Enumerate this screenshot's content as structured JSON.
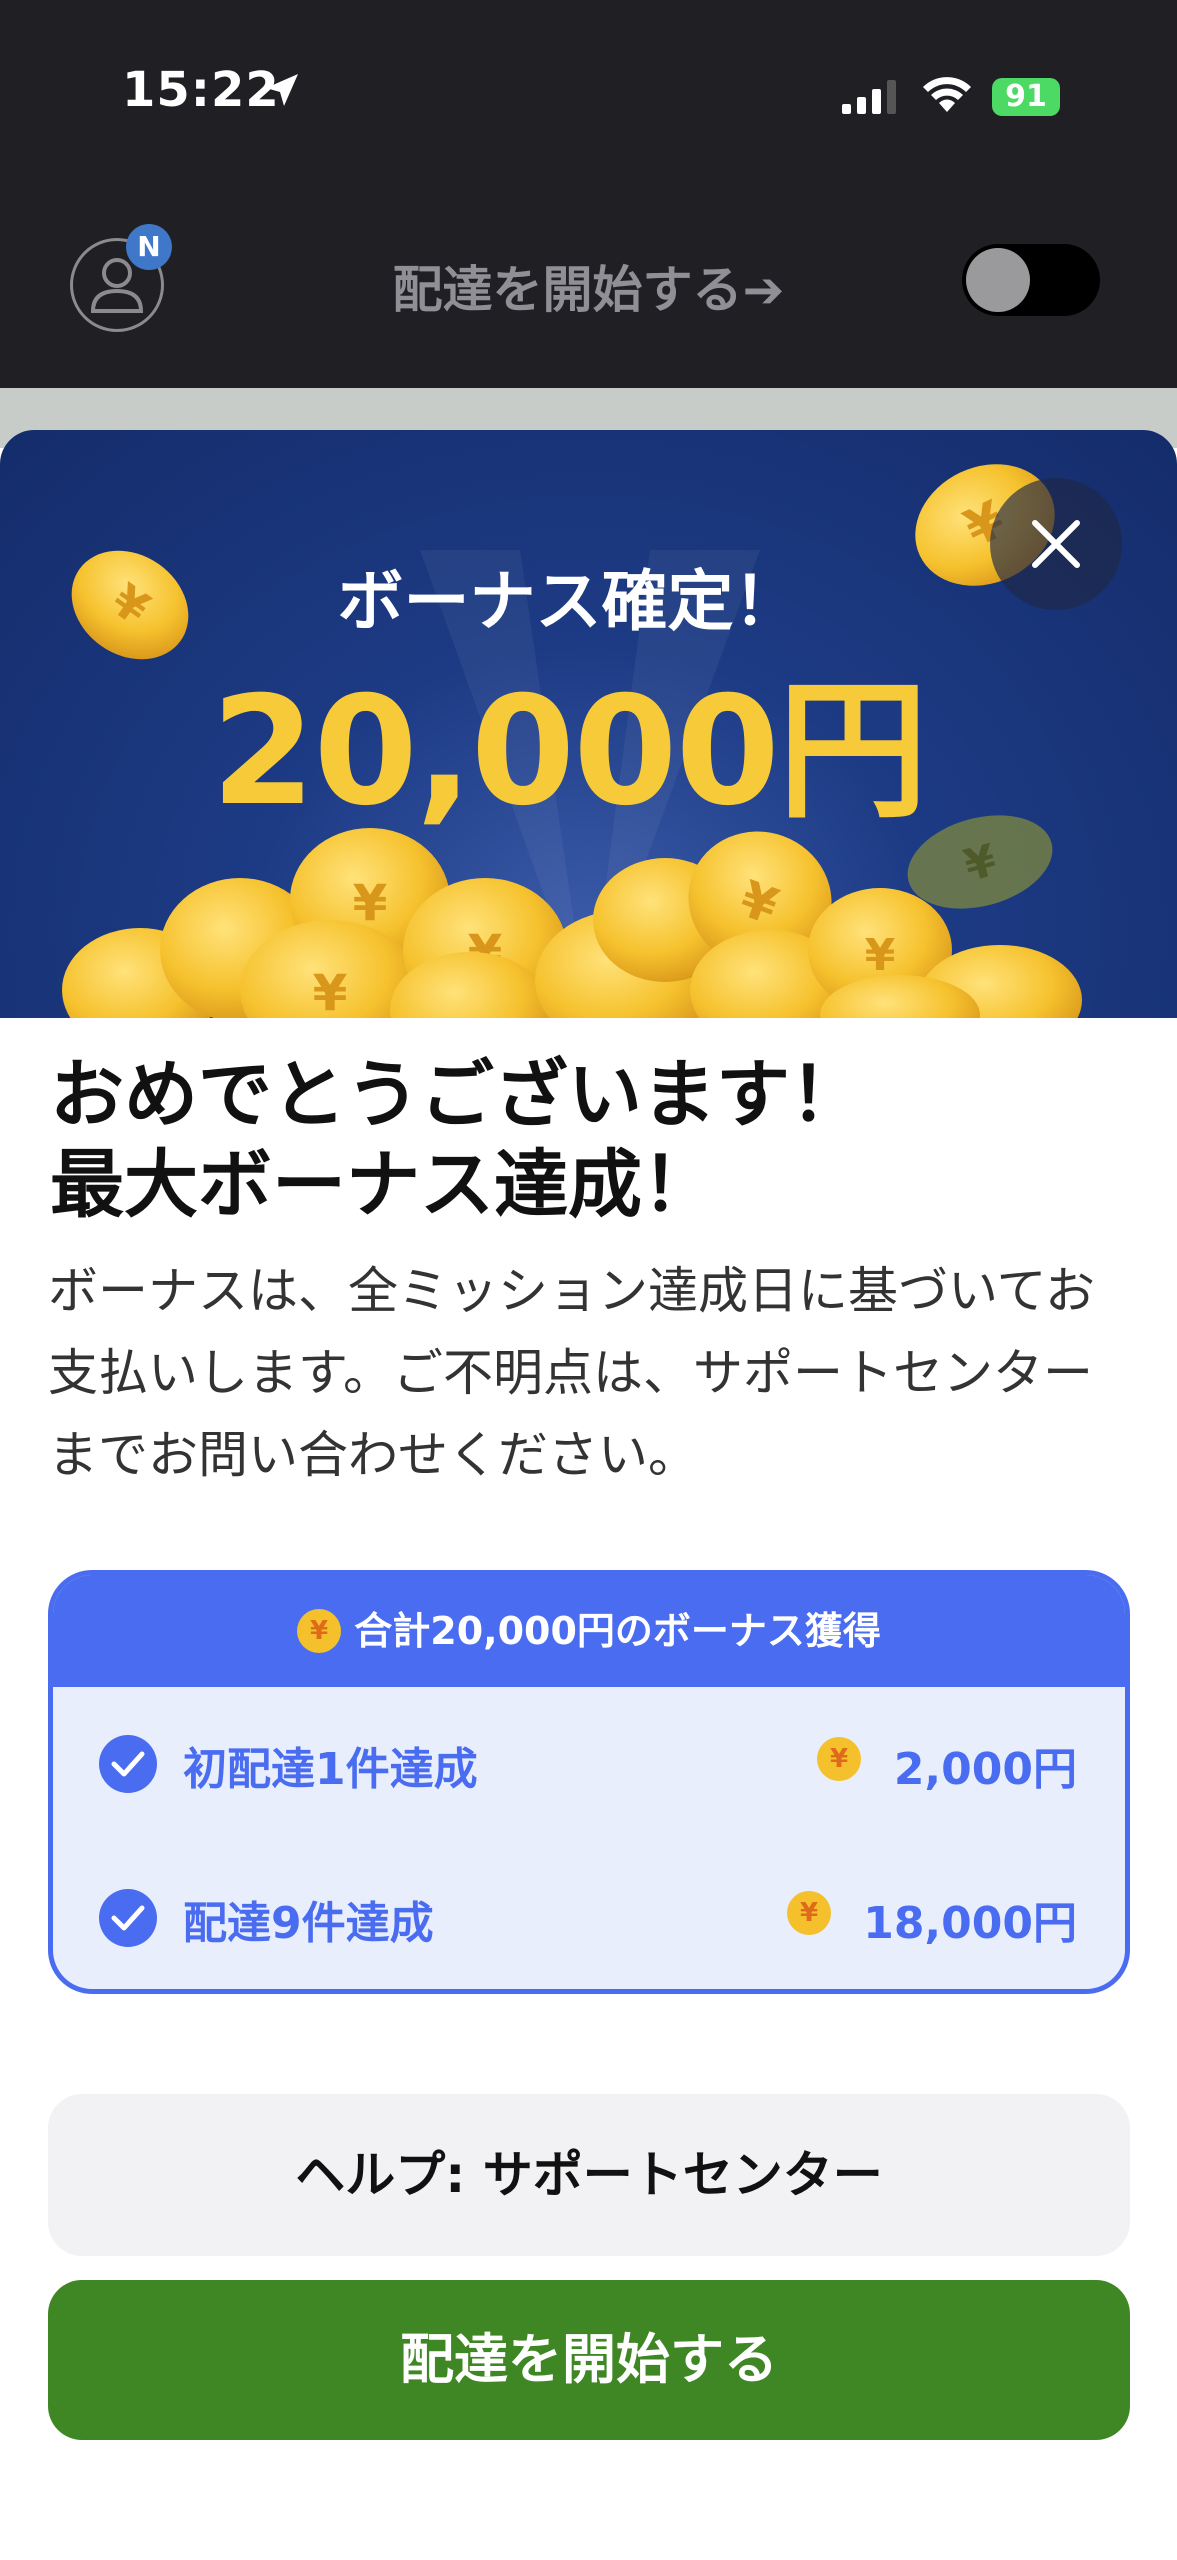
{
  "status_bar": {
    "time": "15:22",
    "battery": "91"
  },
  "header": {
    "badge": "N",
    "title": "配達を開始する➔"
  },
  "modal": {
    "hero_subtitle": "ボーナス確定！",
    "hero_amount": "20,000円",
    "congrats_line1": "おめでとうございます！",
    "congrats_line2": "最大ボーナス達成！",
    "body": "ボーナスは、全ミッション達成日に基づいてお支払いします。ご不明点は、サポートセンターまでお問い合わせください。",
    "card": {
      "yen_symbol": "¥",
      "header": "合計20,000円のボーナス獲得",
      "items": [
        {
          "label": "初配達1件達成",
          "amount": "2,000円"
        },
        {
          "label": "配達9件達成",
          "amount": "18,000円"
        }
      ]
    },
    "help_button": "ヘルプ: サポートセンター",
    "start_button": "配達を開始する"
  },
  "colors": {
    "accent_blue": "#4a6cf0",
    "gold": "#f7ca39",
    "start_green": "#3f8724"
  }
}
